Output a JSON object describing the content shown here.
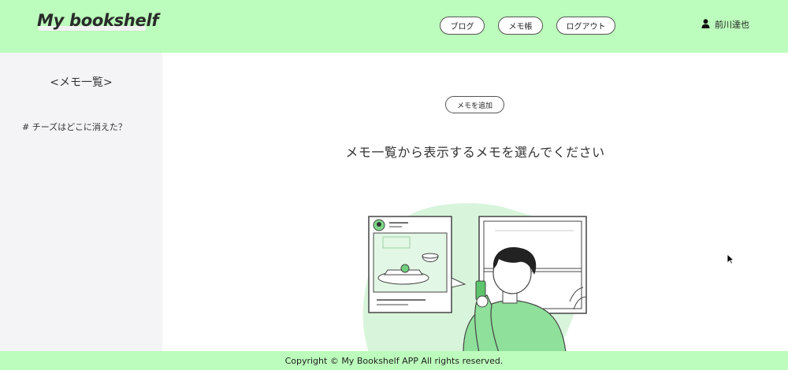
{
  "header": {
    "logo": "My bookshelf",
    "nav": {
      "blog": "ブログ",
      "memo": "メモ帳",
      "logout": "ログアウト"
    },
    "user_name": "前川達也",
    "bg_color": "#bcfcbc"
  },
  "sidebar": {
    "title": "<メモ一覧>",
    "items": [
      {
        "label": "# チーズはどこに消えた？"
      }
    ]
  },
  "main": {
    "add_button": "メモを追加",
    "message": "メモ一覧から表示するメモを選んでください"
  },
  "footer": {
    "copyright": "Copyright © My Bookshelf APP All rights reserved."
  }
}
